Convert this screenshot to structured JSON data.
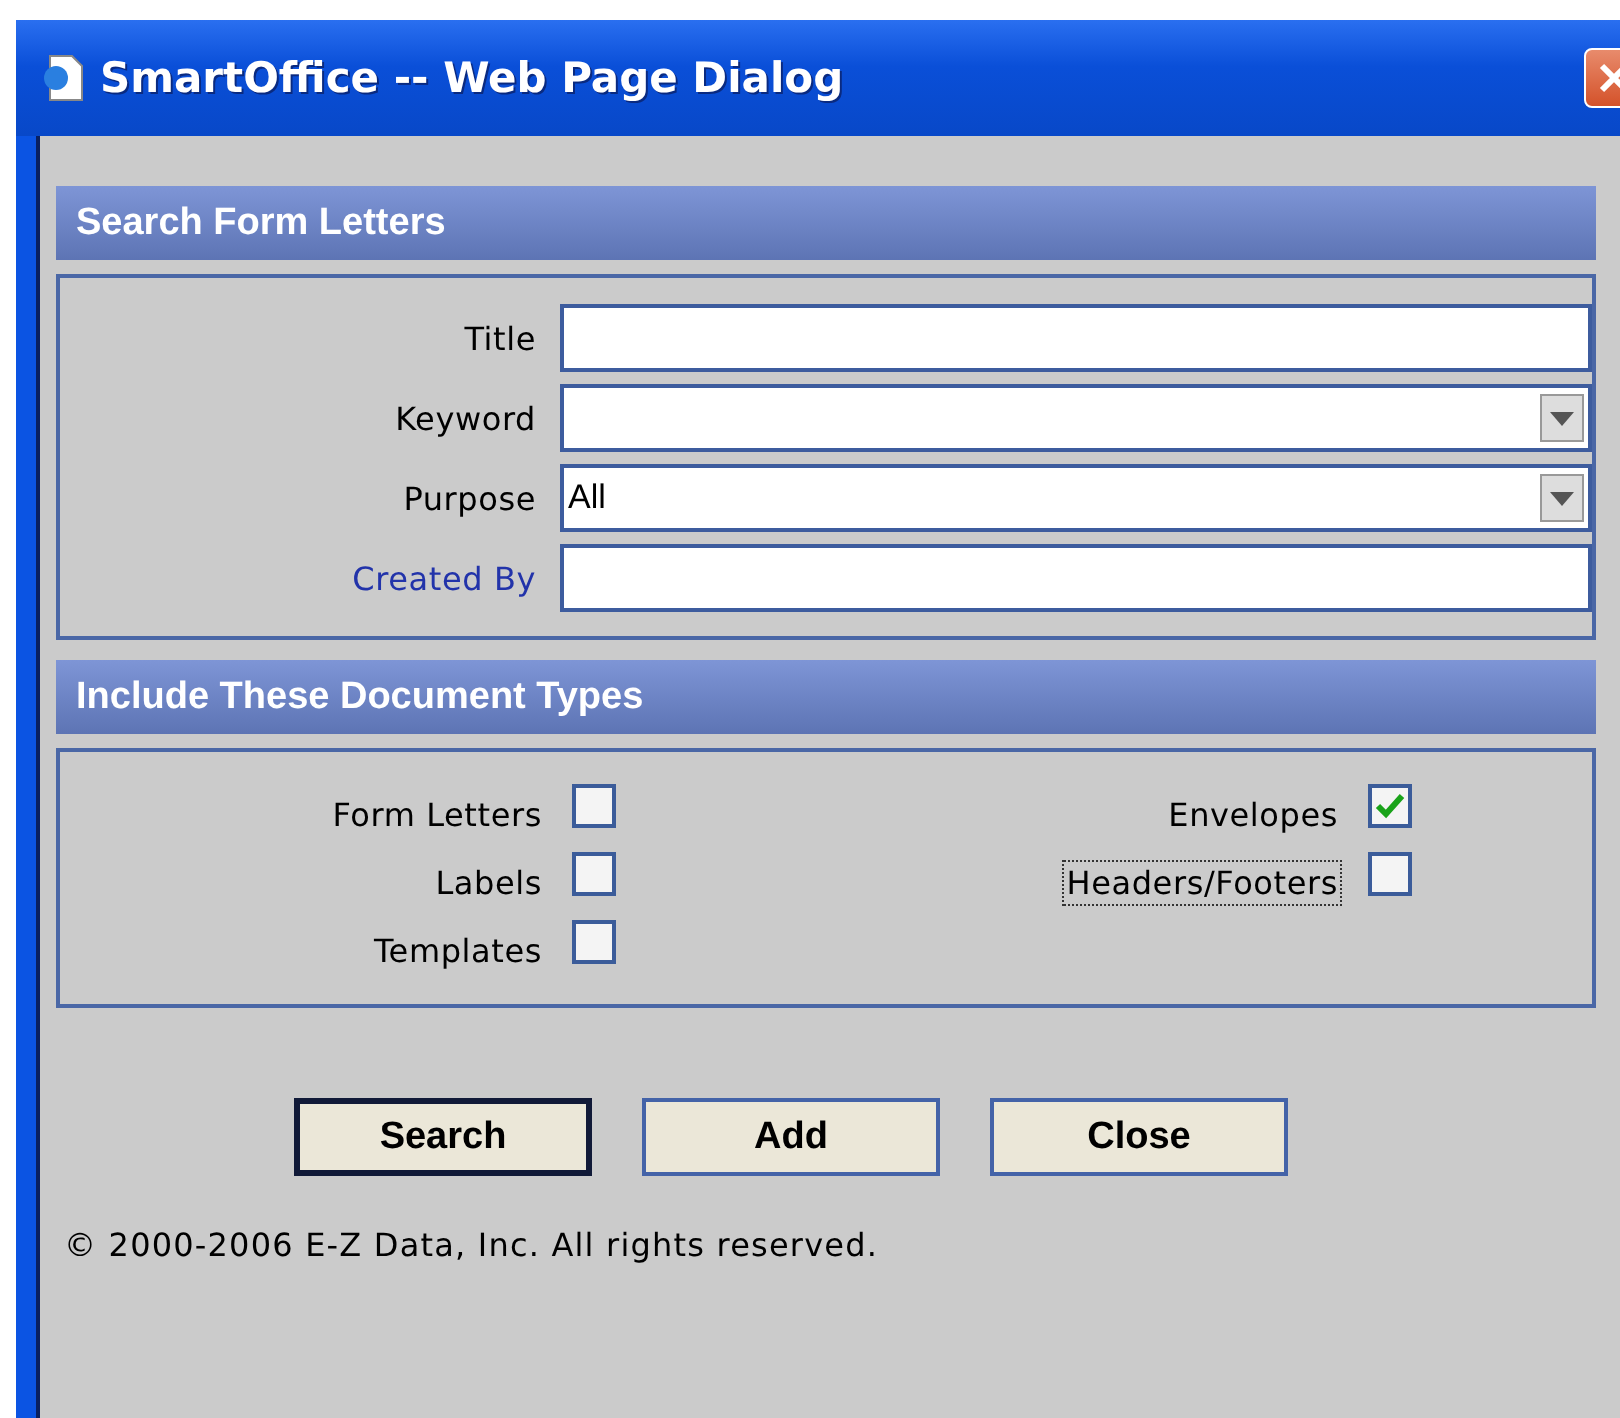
{
  "window": {
    "title": "SmartOffice -- Web Page Dialog"
  },
  "search_section": {
    "heading": "Search Form Letters",
    "fields": [
      {
        "label": "Title",
        "kind": "text",
        "link": false
      },
      {
        "label": "Keyword",
        "kind": "select",
        "link": false
      },
      {
        "label": "Purpose",
        "kind": "select",
        "value": "All",
        "link": false
      },
      {
        "label": "Created By",
        "kind": "text",
        "link": true
      }
    ]
  },
  "types_section": {
    "heading": "Include These Document Types",
    "columns": [
      [
        {
          "label": "Form Letters",
          "checked": false,
          "focused": false
        },
        {
          "label": "Labels",
          "checked": false,
          "focused": false
        },
        {
          "label": "Templates",
          "checked": false,
          "focused": false
        }
      ],
      [
        {
          "label": "Envelopes",
          "checked": true,
          "focused": false
        },
        {
          "label": "Headers/Footers",
          "checked": false,
          "focused": true
        }
      ]
    ]
  },
  "buttons": [
    {
      "label": "Search",
      "default": true
    },
    {
      "label": "Add",
      "default": false
    },
    {
      "label": "Close",
      "default": false
    }
  ],
  "copyright": "© 2000-2006 E-Z Data, Inc. All rights reserved."
}
